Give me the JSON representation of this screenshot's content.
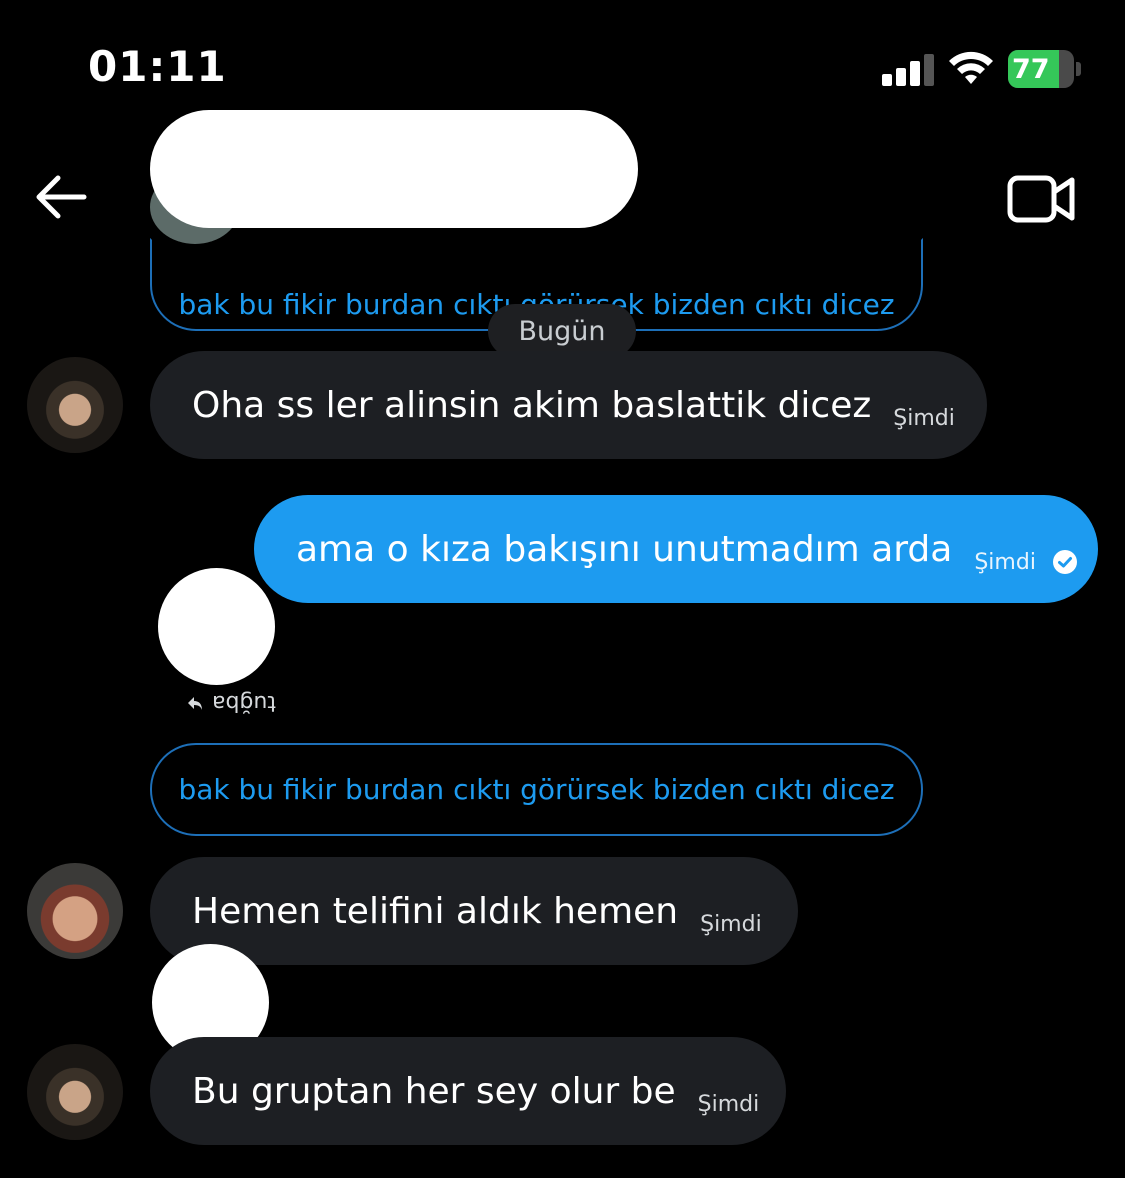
{
  "status_bar": {
    "time": "01:11",
    "battery_level": "77",
    "battery_percent": 77,
    "battery_color": "#35c759"
  },
  "header": {
    "back_icon": "arrow-left-icon",
    "video_icon": "video-camera-icon"
  },
  "accent_color": "#1d9bf0",
  "messages": {
    "quote_1": "bak bu fikir burdan cıktı görürsek bizden cıktı dicez",
    "date_separator": "Bugün",
    "msg_1": {
      "text": "Oha ss ler alinsin akim baslattik dicez",
      "time": "Şimdi"
    },
    "msg_2": {
      "text": "ama o kıza bakışını unutmadım arda",
      "time": "Şimdi",
      "sent_icon": "check-circle-icon"
    },
    "reply_to": "tuğba",
    "reply_icon": "reply-arrow-icon",
    "quote_2": "bak bu fikir burdan cıktı görürsek bizden cıktı dicez",
    "msg_3": {
      "text": "Hemen telifini aldık hemen",
      "time": "Şimdi"
    },
    "msg_4": {
      "text": "Bu gruptan her sey olur be",
      "time": "Şimdi"
    }
  }
}
